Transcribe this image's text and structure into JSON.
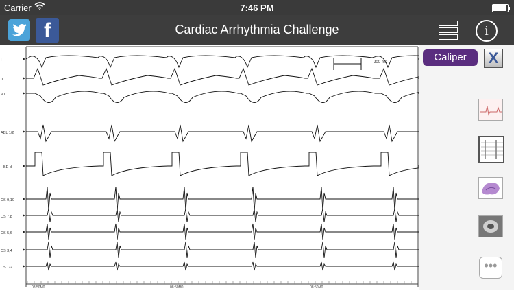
{
  "status": {
    "carrier": "Carrier",
    "time": "7:46 PM"
  },
  "nav": {
    "title": "Cardiac Arrhythmia Challenge",
    "info_label": "i",
    "fb_label": "f"
  },
  "caliper": {
    "label": "Caliper",
    "close_label": "X",
    "measure_label": "200 ms"
  },
  "channels": [
    "I",
    "II",
    "V1",
    "ABL 1/2",
    "HBE d",
    "CS 9,10",
    "CS 7,8",
    "CS 5,6",
    "CS 3,4",
    "CS 1/2"
  ],
  "timestamps": [
    "08:50M0",
    "08:50M0",
    "08:50M0"
  ],
  "colors": {
    "caliper": "#5a2d7f",
    "navbar": "#3d3d3d",
    "twitter": "#4ba3d9",
    "facebook": "#3b5998"
  },
  "icons": [
    "twitter-icon",
    "facebook-icon",
    "list-icon",
    "info-icon",
    "close-icon",
    "ecg-thumb-icon",
    "ep-thumb-icon",
    "map-thumb-icon",
    "xray-thumb-icon",
    "more-icon"
  ]
}
